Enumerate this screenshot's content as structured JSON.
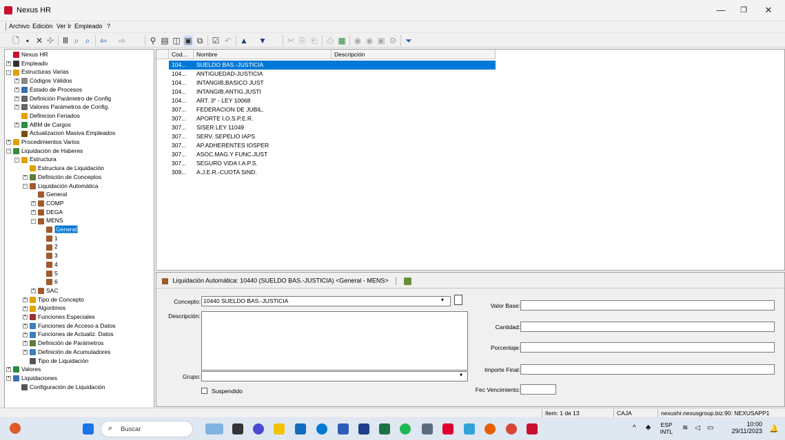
{
  "window": {
    "title": "Nexus HR",
    "min": "—",
    "max": "❐",
    "close": "✕"
  },
  "menu": [
    "Archivo",
    "Edición",
    "Ver",
    "Ir",
    "Empleado",
    "?"
  ],
  "toolbar_icons": [
    "new-icon",
    "save-icon",
    "delete-icon",
    "refresh-icon",
    "columns-icon",
    "search-icon",
    "find-icon",
    "back-icon",
    "forward-icon",
    "pin-icon",
    "report-icon",
    "view1-icon",
    "view2-icon",
    "copy-icon",
    "check-icon",
    "undo-icon",
    "up-icon",
    "down-icon",
    "cut-icon",
    "copy2-icon",
    "paste-icon",
    "print-icon",
    "chart-icon",
    "run-icon",
    "run2-icon",
    "export-icon",
    "settings-icon",
    "filter-icon"
  ],
  "tree": [
    {
      "label": "Nexus HR",
      "lvl": 0,
      "pm": "",
      "icon": "#c8102e"
    },
    {
      "label": "Empleado",
      "lvl": 0,
      "pm": "+",
      "icon": "#333"
    },
    {
      "label": "Estructuras Varias",
      "lvl": 0,
      "pm": "-",
      "icon": "#e2a100"
    },
    {
      "label": "Códigos Válidos",
      "lvl": 1,
      "pm": "+",
      "icon": "#888"
    },
    {
      "label": "Estado de Procesos",
      "lvl": 1,
      "pm": "+",
      "icon": "#3a6fb0"
    },
    {
      "label": "Definición Parámetro de Config",
      "lvl": 1,
      "pm": "+",
      "icon": "#666"
    },
    {
      "label": "Valores Parámetros de Config.",
      "lvl": 1,
      "pm": "+",
      "icon": "#666"
    },
    {
      "label": "Definicion Feriados",
      "lvl": 1,
      "pm": "",
      "icon": "#e2a100"
    },
    {
      "label": "ABM de Cargos",
      "lvl": 1,
      "pm": "+",
      "icon": "#2b8a3e"
    },
    {
      "label": "Actualizacion Masiva Empleados",
      "lvl": 1,
      "pm": "",
      "icon": "#7a4b12"
    },
    {
      "label": "Procedimientos Varios",
      "lvl": 0,
      "pm": "+",
      "icon": "#e2a100"
    },
    {
      "label": "Liquidación de Haberes",
      "lvl": 0,
      "pm": "-",
      "icon": "#3a8a3a"
    },
    {
      "label": "Estructura",
      "lvl": 1,
      "pm": "-",
      "icon": "#e2a100"
    },
    {
      "label": "Estructura de Liquidación",
      "lvl": 2,
      "pm": "",
      "icon": "#e2a100"
    },
    {
      "label": "Definición de Conceptos",
      "lvl": 2,
      "pm": "+",
      "icon": "#5a7d3a"
    },
    {
      "label": "Liquidación Automática",
      "lvl": 2,
      "pm": "-",
      "icon": "#a05a2c"
    },
    {
      "label": "General",
      "lvl": 3,
      "pm": "",
      "icon": "#a05a2c"
    },
    {
      "label": "COMP",
      "lvl": 3,
      "pm": "+",
      "icon": "#a05a2c"
    },
    {
      "label": "DEGA",
      "lvl": 3,
      "pm": "+",
      "icon": "#a05a2c"
    },
    {
      "label": "MENS",
      "lvl": 3,
      "pm": "-",
      "icon": "#a05a2c"
    },
    {
      "label": "General",
      "lvl": 4,
      "pm": "",
      "icon": "#a05a2c",
      "selected": true
    },
    {
      "label": "1",
      "lvl": 4,
      "pm": "",
      "icon": "#a05a2c"
    },
    {
      "label": "2",
      "lvl": 4,
      "pm": "",
      "icon": "#a05a2c"
    },
    {
      "label": "3",
      "lvl": 4,
      "pm": "",
      "icon": "#a05a2c"
    },
    {
      "label": "4",
      "lvl": 4,
      "pm": "",
      "icon": "#a05a2c"
    },
    {
      "label": "5",
      "lvl": 4,
      "pm": "",
      "icon": "#a05a2c"
    },
    {
      "label": "6",
      "lvl": 4,
      "pm": "",
      "icon": "#a05a2c"
    },
    {
      "label": "SAC",
      "lvl": 3,
      "pm": "+",
      "icon": "#a05a2c"
    },
    {
      "label": "Tipo de Concepto",
      "lvl": 2,
      "pm": "+",
      "icon": "#e2a100"
    },
    {
      "label": "Algoritmos",
      "lvl": 2,
      "pm": "+",
      "icon": "#e2a100"
    },
    {
      "label": "Funciones Especiales",
      "lvl": 2,
      "pm": "+",
      "icon": "#a03030"
    },
    {
      "label": "Funciones de Acceso a Datos",
      "lvl": 2,
      "pm": "+",
      "icon": "#3a7fc0"
    },
    {
      "label": "Funciones de Actualiz. Datos",
      "lvl": 2,
      "pm": "+",
      "icon": "#3a7fc0"
    },
    {
      "label": "Definición de Parámetros",
      "lvl": 2,
      "pm": "+",
      "icon": "#5a7d3a"
    },
    {
      "label": "Definición de Acumuladores",
      "lvl": 2,
      "pm": "+",
      "icon": "#3a7fc0"
    },
    {
      "label": "Tipo de Liquidación",
      "lvl": 2,
      "pm": "",
      "icon": "#555"
    },
    {
      "label": "Valores",
      "lvl": 0,
      "pm": "+",
      "icon": "#2b8a3e"
    },
    {
      "label": "Liquidaciones",
      "lvl": 0,
      "pm": "+",
      "icon": "#3a6fb0"
    },
    {
      "label": "Configuración de Liquidación",
      "lvl": 1,
      "pm": "",
      "icon": "#555"
    }
  ],
  "grid": {
    "columns": [
      "Cod...",
      "Nombre",
      "Descripción"
    ],
    "rows": [
      [
        "104...",
        "SUELDO BAS.-JUSTICIA",
        ""
      ],
      [
        "104...",
        "ANTIGUEDAD-JUSTICIA",
        ""
      ],
      [
        "104...",
        "INTANGIB.BASICO JUST",
        ""
      ],
      [
        "104...",
        "INTANGIB.ANTIG.JUSTI",
        ""
      ],
      [
        "104...",
        "ART. 3° - LEY 10068",
        ""
      ],
      [
        "307...",
        "FEDERACION DE JUBIL.",
        ""
      ],
      [
        "307...",
        "APORTE I.O.S.P.E.R.",
        ""
      ],
      [
        "307...",
        "SISER LEY 11049",
        ""
      ],
      [
        "307...",
        "SERV. SEPELIO IAPS",
        ""
      ],
      [
        "307...",
        "AP.ADHERENTES IOSPER",
        ""
      ],
      [
        "307...",
        "ASOC.MAG.Y FUNC.JUST",
        ""
      ],
      [
        "307...",
        "SEGURO VIDA I.A.P.S.",
        ""
      ],
      [
        "309...",
        "A.J.E.R.-CUOTA SIND.",
        ""
      ]
    ]
  },
  "detail": {
    "title": "Liquidación Automática: 10440  (SUELDO BAS.-JUSTICIA)  <General - MENS>",
    "concepto_label": "Concepto:",
    "concepto_value": "10440  SUELDO BAS.-JUSTICIA",
    "descripcion_label": "Descripción:",
    "descripcion_value": "",
    "grupo_label": "Grupo:",
    "grupo_value": "",
    "suspendido_label": "Suspendido",
    "valor_base_label": "Valor Base:",
    "valor_base": "",
    "cantidad_label": "Cantidad:",
    "cantidad": "",
    "porcentaje_label": "Porcentaje:",
    "porcentaje": "",
    "importe_final_label": "Importe Final:",
    "importe_final": "",
    "fec_venc_label": "Fec Vencimiento:",
    "fec_venc": ""
  },
  "status": {
    "item": "Item:  1 de 13",
    "caja": "CAJA",
    "server": "nexushr.nexusgroup.biz:90: NEXUSAPP1"
  },
  "taskbar": {
    "search": "Buscar",
    "lang1": "ESP",
    "lang2": "INTL",
    "time": "10:00",
    "date": "29/11/2023"
  }
}
